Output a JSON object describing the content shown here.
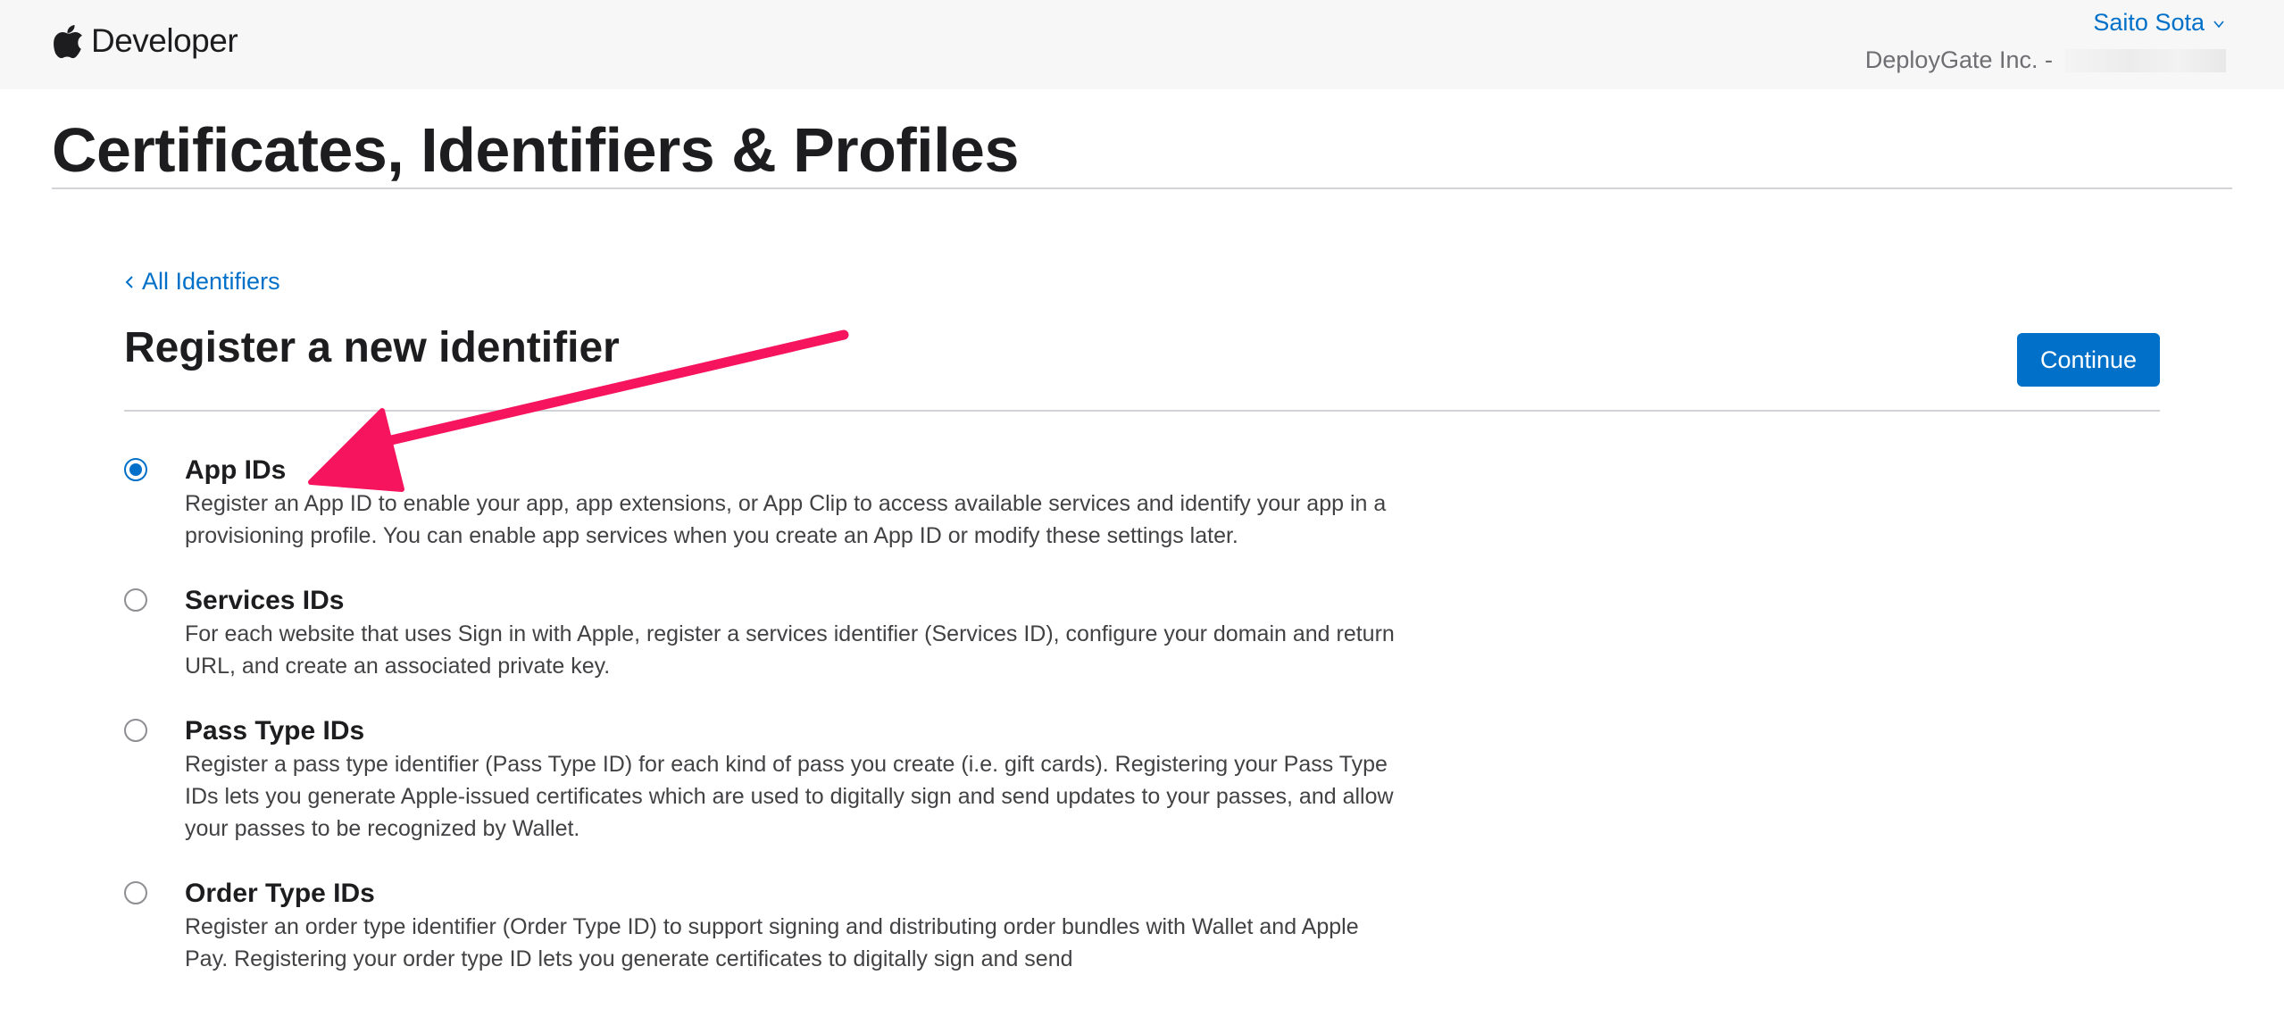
{
  "header": {
    "brand_label": "Developer",
    "user_name": "Saito Sota",
    "team_name": "DeployGate Inc. -"
  },
  "page": {
    "title": "Certificates, Identifiers & Profiles"
  },
  "nav": {
    "back_label": "All Identifiers"
  },
  "section": {
    "title": "Register a new identifier",
    "continue_label": "Continue"
  },
  "options": [
    {
      "title": "App IDs",
      "description": "Register an App ID to enable your app, app extensions, or App Clip to access available services and identify your app in a provisioning profile. You can enable app services when you create an App ID or modify these settings later.",
      "selected": true
    },
    {
      "title": "Services IDs",
      "description": "For each website that uses Sign in with Apple, register a services identifier (Services ID), configure your domain and return URL, and create an associated private key.",
      "selected": false
    },
    {
      "title": "Pass Type IDs",
      "description": "Register a pass type identifier (Pass Type ID) for each kind of pass you create (i.e. gift cards). Registering your Pass Type IDs lets you generate Apple-issued certificates which are used to digitally sign and send updates to your passes, and allow your passes to be recognized by Wallet.",
      "selected": false
    },
    {
      "title": "Order Type IDs",
      "description": "Register an order type identifier (Order Type ID) to support signing and distributing order bundles with Wallet and Apple Pay. Registering your order type ID lets you generate certificates to digitally sign and send",
      "selected": false
    }
  ],
  "colors": {
    "accent": "#0070c9",
    "annotation_arrow": "#f7145f",
    "header_bg": "#f7f7f7"
  },
  "icons": {
    "logo": "apple-logo-icon",
    "user_menu": "chevron-down-icon",
    "back": "chevron-left-icon"
  }
}
